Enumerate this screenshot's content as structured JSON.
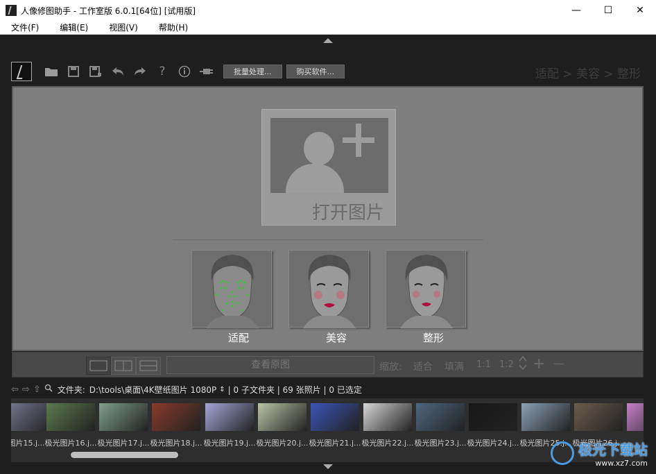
{
  "window": {
    "title": "人像修图助手 - 工作室版 6.0.1[64位] [试用版]",
    "minimize": "—",
    "maximize": "☐",
    "close": "✕"
  },
  "menu": [
    "文件(F)",
    "编辑(E)",
    "视图(V)",
    "帮助(H)"
  ],
  "toolbar": {
    "icons": [
      "open-folder-icon",
      "save-icon",
      "save-as-icon",
      "undo-icon",
      "redo-icon",
      "help-icon",
      "info-icon",
      "plugin-icon"
    ],
    "batch_button": "批量处理...",
    "buy_button": "购买软件..."
  },
  "workflow": "适配 > 美容 > 整形",
  "canvas": {
    "open_label": "打开图片",
    "faces": [
      "适配",
      "美容",
      "整形"
    ]
  },
  "status": {
    "view_original": "查看原图",
    "zoom_label": "缩放:",
    "fit": "适合",
    "fill": "填满",
    "ratio1": "1:1",
    "ratio2": "1:2",
    "plus": "+",
    "minus": "—"
  },
  "path": {
    "folder_label": "文件夹:",
    "folder_path": "D:\\tools\\桌面\\4K壁纸图片 1080P",
    "info": "| 0 子文件夹 | 69 张照片 | 0 已选定"
  },
  "thumbnails": [
    {
      "label": "图片15.j...",
      "color": "#7d7f98"
    },
    {
      "label": "极光图片16.j...",
      "color": "#5c7a4f"
    },
    {
      "label": "极光图片17.j...",
      "color": "#7fa08a"
    },
    {
      "label": "极光图片18.j...",
      "color": "#8a3a2a"
    },
    {
      "label": "极光图片19.j...",
      "color": "#a4a6d8"
    },
    {
      "label": "极光图片20.j...",
      "color": "#b9c4a6"
    },
    {
      "label": "极光图片21.j...",
      "color": "#3b54b8"
    },
    {
      "label": "极光图片22.j...",
      "color": "#d8d6d8"
    },
    {
      "label": "极光图片23.j...",
      "color": "#4f6780"
    },
    {
      "label": "极光图片24.j...",
      "color": "#181818"
    },
    {
      "label": "极光图片25.j...",
      "color": "#8ba2b6"
    },
    {
      "label": "极光图片26.j...",
      "color": "#6b5d4d"
    },
    {
      "label": "极光",
      "color": "#c57fc8"
    }
  ],
  "watermark": {
    "main": "极光下载站",
    "sub": "www.xz7.com"
  }
}
